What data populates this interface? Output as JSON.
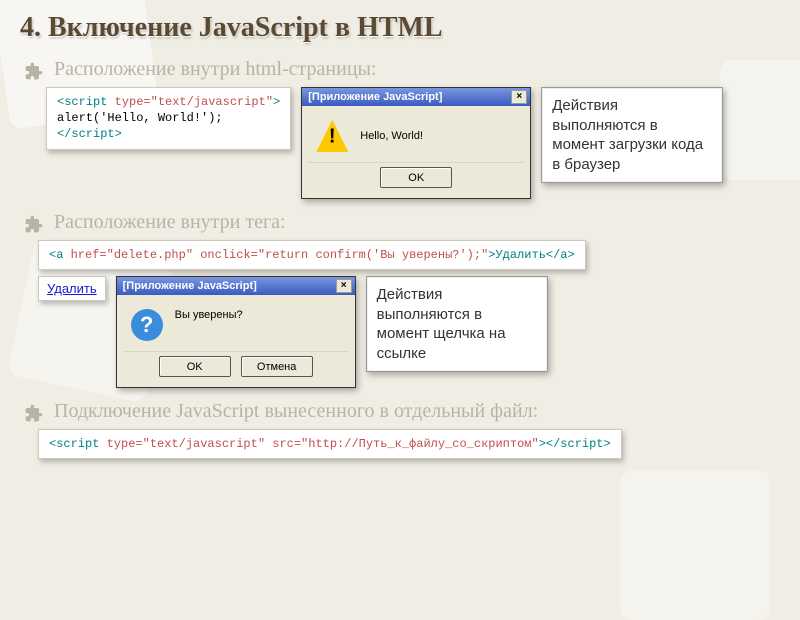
{
  "title": "4. Включение JavaScript в HTML",
  "bullets": {
    "a": "Расположение внутри html-страницы:",
    "b": "Расположение внутри тега:",
    "c": "Подключение JavaScript вынесенного в отдельный файл:"
  },
  "code": {
    "a_line1_open": "<script ",
    "a_line1_attr": "type=\"text/javascript\"",
    "a_line1_close": ">",
    "a_line2": "alert('Hello, World!');",
    "a_line3": "</script>",
    "b_line_open": "<a ",
    "b_line_attr": "href=\"delete.php\" onclick=\"return confirm('Вы уверены?');\"",
    "b_line_mid": ">Удалить<",
    "b_line_close": "/a>",
    "c_line_open": "<script ",
    "c_line_attr": "type=\"text/javascript\" src=\"http://Путь_к_файлу_со_скриптом\"",
    "c_line_mid": "><",
    "c_line_close": "/script>"
  },
  "dialog1": {
    "title": "[Приложение JavaScript]",
    "msg": "Hello, World!",
    "ok": "OK"
  },
  "dialog2": {
    "title": "[Приложение JavaScript]",
    "msg": "Вы уверены?",
    "ok": "OK",
    "cancel": "Отмена"
  },
  "notes": {
    "n1": "Действия выполняются в момент загрузки кода в браузер",
    "n2": "Действия выполняются в момент щелчка на ссылке"
  },
  "link_preview": "Удалить"
}
